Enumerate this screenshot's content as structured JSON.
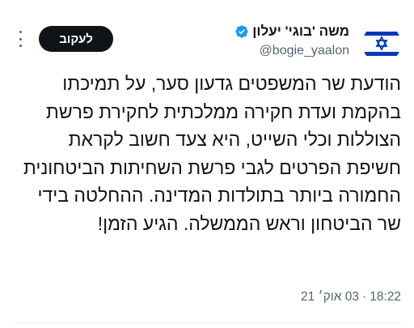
{
  "user": {
    "display_name": "משה 'בוגי' יעלון",
    "handle": "@bogie_yaalon",
    "verified": true,
    "avatar_icon": "israel-flag-icon"
  },
  "actions": {
    "follow_label": "לעקוב",
    "more_icon": "more-dots-icon"
  },
  "tweet": {
    "text": "הודעת שר המשפטים גדעון סער, על תמיכתו בהקמת ועדת חקירה ממלכתית לחקירת פרשת הצוללות וכלי השייט, היא צעד חשוב לקראת חשיפת הפרטים לגבי פרשת השחיתות הביטחונית החמורה ביותר בתולדות המדינה. ההחלטה בידי שר הביטחון וראש הממשלה. הגיע הזמן!",
    "time": "18:22",
    "separator": "·",
    "date": "03 אוק׳ 21"
  },
  "colors": {
    "text": "#0f1419",
    "secondary": "#536471",
    "verified": "#1d9bf0",
    "flag_blue": "#0038b8"
  }
}
